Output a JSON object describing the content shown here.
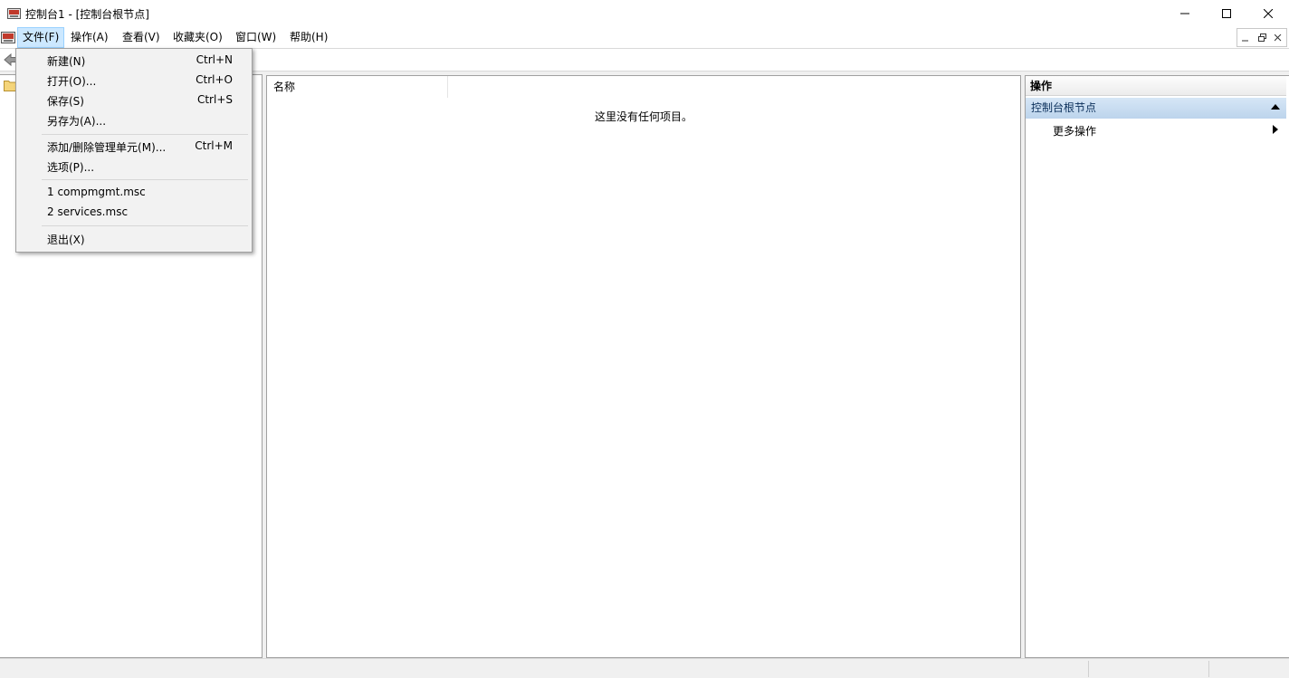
{
  "window": {
    "title": "控制台1 - [控制台根节点]"
  },
  "menubar": {
    "items": [
      "文件(F)",
      "操作(A)",
      "查看(V)",
      "收藏夹(O)",
      "窗口(W)",
      "帮助(H)"
    ]
  },
  "file_menu": {
    "items": [
      {
        "label": "新建(N)",
        "shortcut": "Ctrl+N"
      },
      {
        "label": "打开(O)...",
        "shortcut": "Ctrl+O"
      },
      {
        "label": "保存(S)",
        "shortcut": "Ctrl+S"
      },
      {
        "label": "另存为(A)...",
        "shortcut": ""
      },
      {
        "label": "添加/删除管理单元(M)...",
        "shortcut": "Ctrl+M"
      },
      {
        "label": "选项(P)...",
        "shortcut": ""
      },
      {
        "label": "1 compmgmt.msc",
        "shortcut": ""
      },
      {
        "label": "2 services.msc",
        "shortcut": ""
      },
      {
        "label": "退出(X)",
        "shortcut": ""
      }
    ]
  },
  "list": {
    "column_name": "名称",
    "empty_message": "这里没有任何项目。"
  },
  "actions": {
    "title": "操作",
    "section": "控制台根节点",
    "more": "更多操作"
  },
  "icons": {
    "app": "mmc-console-icon",
    "back": "back-arrow-icon",
    "folder": "folder-icon"
  },
  "colors": {
    "menu_active_bg": "#cce8ff",
    "actions_section_bg": "#bcd4ec"
  }
}
